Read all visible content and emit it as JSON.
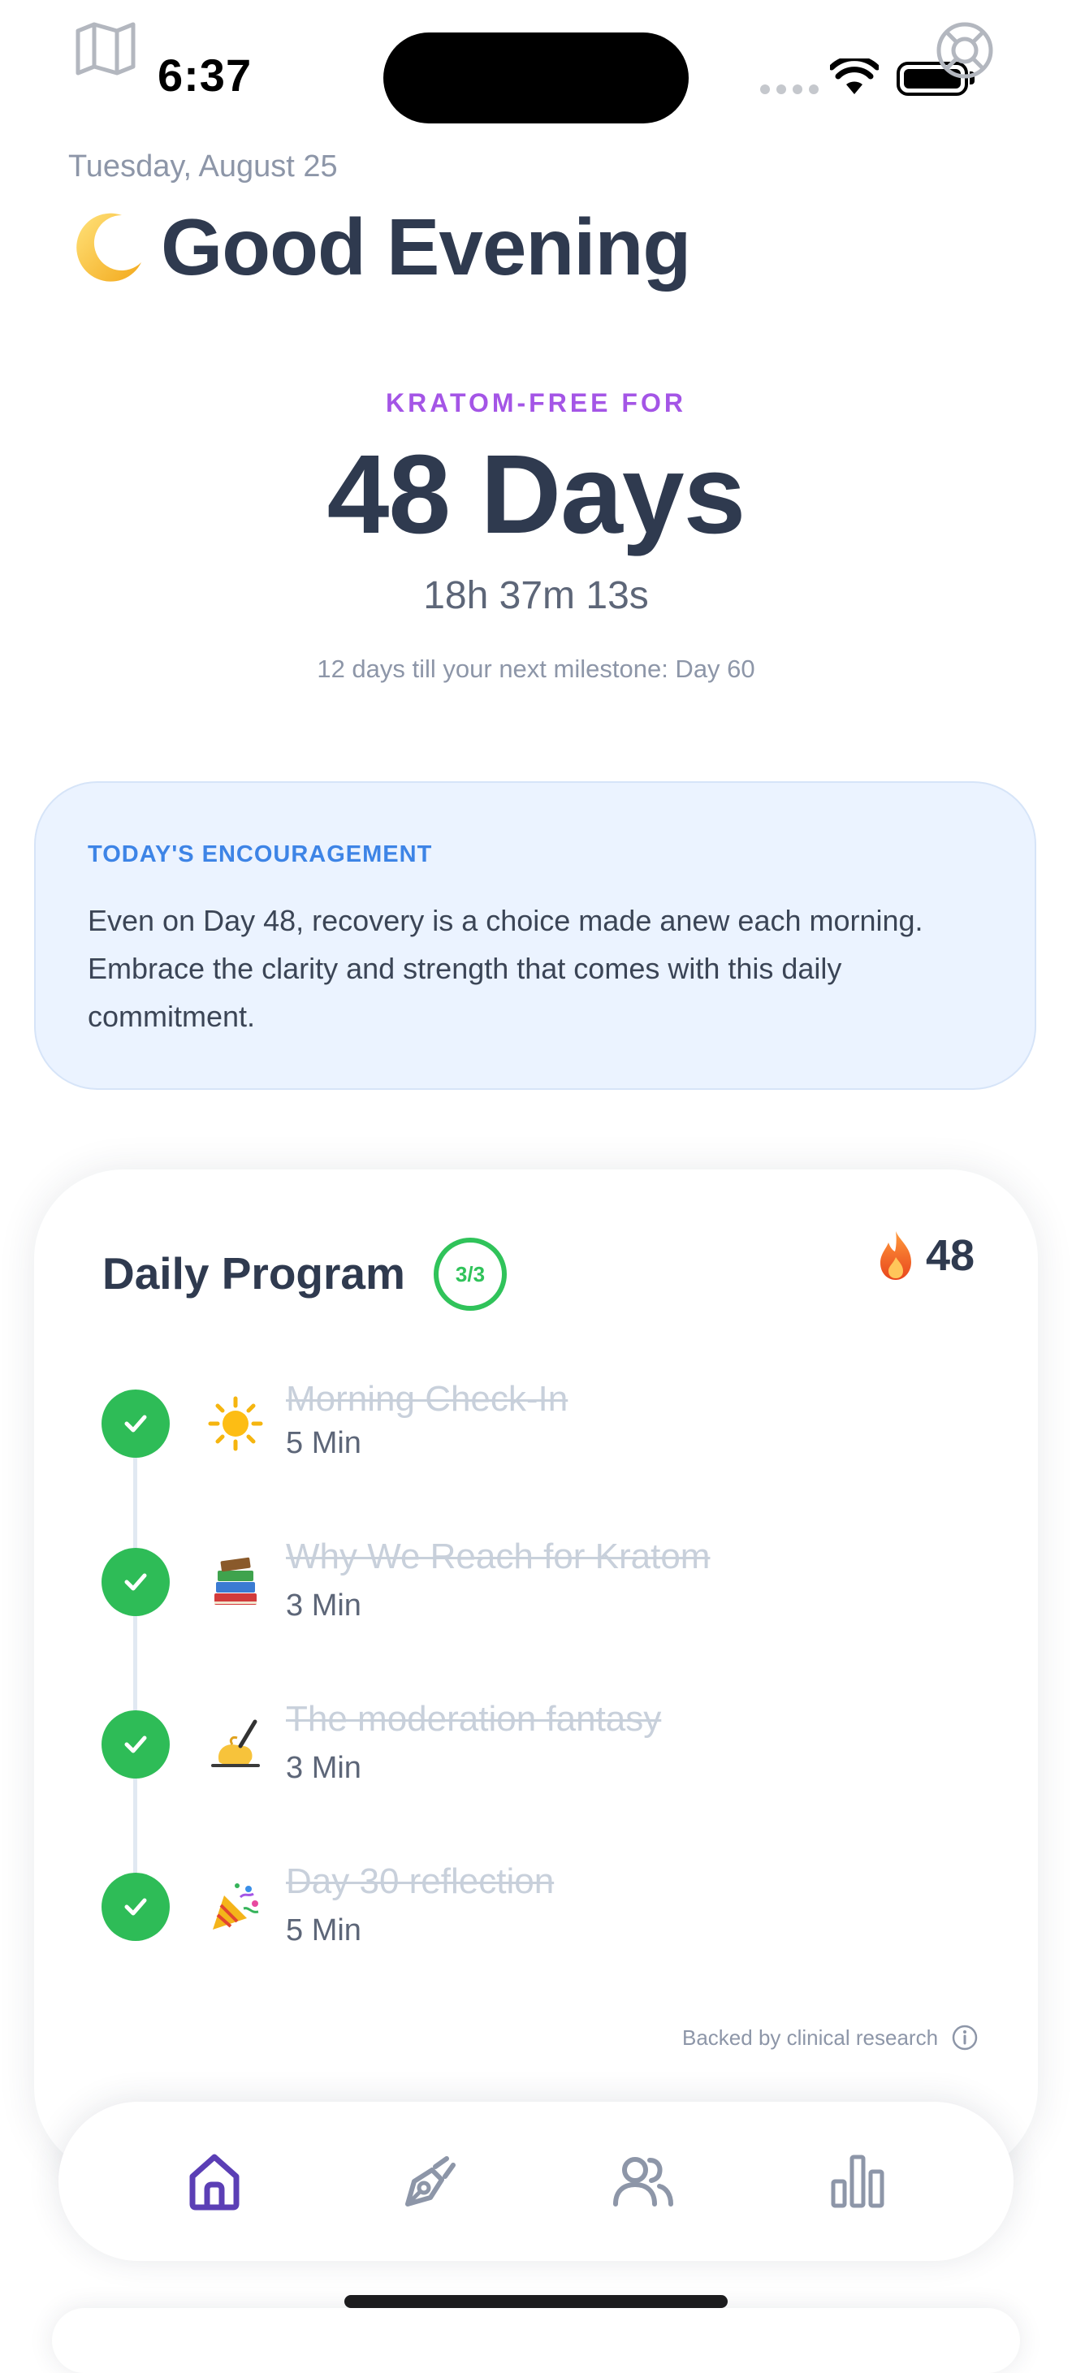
{
  "status_bar": {
    "time": "6:37"
  },
  "header": {
    "date": "Tuesday, August 25",
    "greeting": "Good Evening",
    "greeting_icon": "crescent-moon-emoji"
  },
  "counter": {
    "label": "KRATOM-FREE FOR",
    "days": "48 Days",
    "timer": "18h 37m 13s",
    "milestone": "12 days till your next milestone: Day 60"
  },
  "encouragement": {
    "title": "TODAY'S ENCOURAGEMENT",
    "text": "Even on Day 48, recovery is a choice made anew each morning. Embrace the clarity and strength that comes with this daily commitment."
  },
  "program": {
    "title": "Daily Program",
    "progress": "3/3",
    "streak": "48",
    "items": [
      {
        "icon": "sun-emoji",
        "title": "Morning Check-In",
        "duration": "5 Min",
        "completed": true
      },
      {
        "icon": "books-emoji",
        "title": "Why We Reach for Kratom",
        "duration": "3 Min",
        "completed": true
      },
      {
        "icon": "writing-hand-emoji",
        "title": "The moderation fantasy",
        "duration": "3 Min",
        "completed": true
      },
      {
        "icon": "party-popper-emoji",
        "title": "Day 30 reflection",
        "duration": "5 Min",
        "completed": true
      }
    ],
    "research_note": "Backed by clinical research"
  },
  "tabs": [
    {
      "icon": "home-icon",
      "active": true
    },
    {
      "icon": "pen-nib-icon",
      "active": false
    },
    {
      "icon": "community-icon",
      "active": false
    },
    {
      "icon": "stats-icon",
      "active": false
    }
  ],
  "colors": {
    "accent_purple": "#a455e6",
    "tab_active": "#5b3fb5",
    "success_green": "#2ebc57",
    "encouragement_blue": "#3d84e6",
    "text_dark": "#2f3a4f"
  }
}
